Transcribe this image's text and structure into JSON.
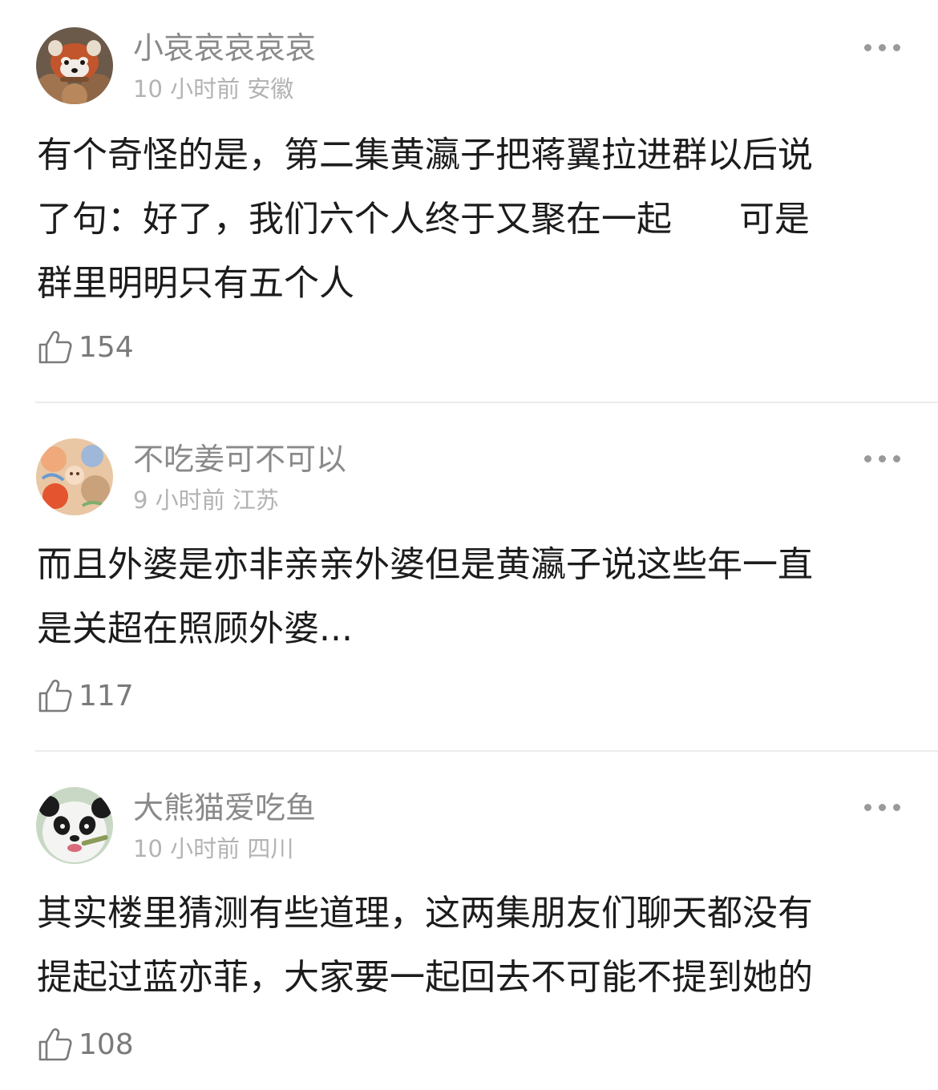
{
  "comments": [
    {
      "username": "小哀哀哀哀哀",
      "time": "10 小时前",
      "location": "安徽",
      "lines": [
        "有个奇怪的是，第二集黄瀛子把蒋翼拉进群以后说",
        "了句：好了，我们六个人终于又聚在一起      可是",
        "群里明明只有五个人"
      ],
      "likes": "154",
      "avatar_icon": "red-panda-avatar"
    },
    {
      "username": "不吃姜可不可以",
      "time": "9 小时前",
      "location": "江苏",
      "lines": [
        "而且外婆是亦非亲亲外婆但是黄瀛子说这些年一直",
        "是关超在照顾外婆..."
      ],
      "likes": "117",
      "avatar_icon": "illustration-avatar"
    },
    {
      "username": "大熊猫爱吃鱼",
      "time": "10 小时前",
      "location": "四川",
      "lines": [
        "其实楼里猜测有些道理，这两集朋友们聊天都没有",
        "提起过蓝亦菲，大家要一起回去不可能不提到她的"
      ],
      "likes": "108",
      "avatar_icon": "panda-avatar"
    }
  ],
  "icons": {
    "like": "thumbs-up-icon",
    "more": "more-dots-icon"
  },
  "colors": {
    "username": "#8a8a8a",
    "meta": "#b3b3b3",
    "body": "#1c1c1c",
    "like_count": "#7a7a7a",
    "divider": "#ececec"
  }
}
